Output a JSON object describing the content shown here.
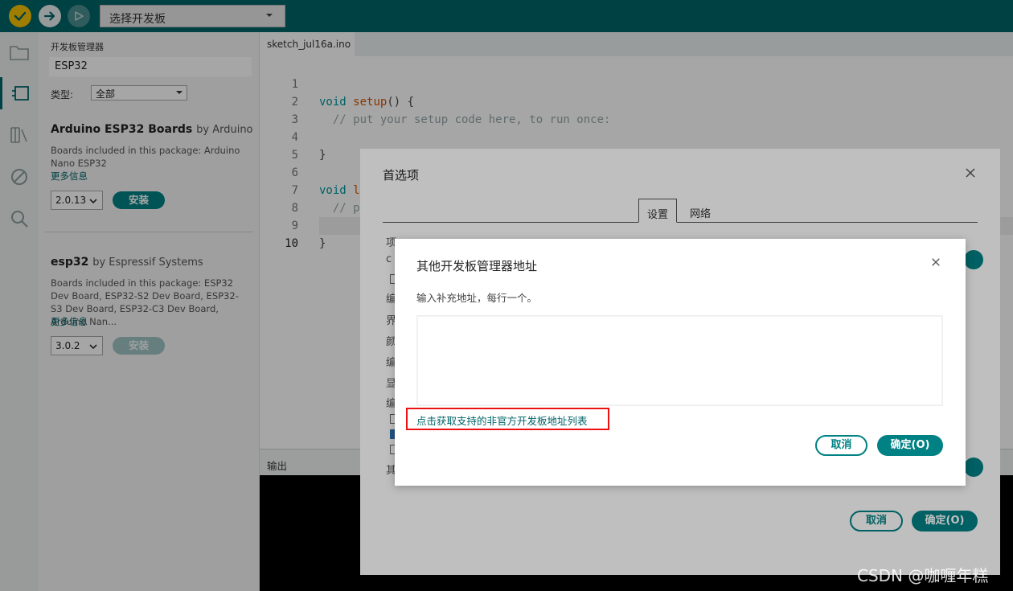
{
  "toolbar": {
    "verify_icon": "check-icon",
    "upload_icon": "arrow-right-icon",
    "debug_icon": "debug-icon",
    "board_select_value": "选择开发板"
  },
  "rail": {
    "items": [
      "folder-icon",
      "boards-manager-icon",
      "library-icon",
      "debug-stop-icon",
      "search-icon"
    ]
  },
  "boards_manager": {
    "title": "开发板管理器",
    "search_value": "ESP32",
    "type_label": "类型:",
    "type_value": "全部",
    "packages": [
      {
        "name": "Arduino ESP32 Boards",
        "by": "by Arduino",
        "description": "Boards included in this package: Arduino Nano ESP32",
        "more_info": "更多信息",
        "version": "2.0.13",
        "install_label": "安装"
      },
      {
        "name": "esp32",
        "by": "by Espressif Systems",
        "description": "Boards included in this package: ESP32 Dev Board, ESP32-S2 Dev Board, ESP32-S3 Dev Board, ESP32-C3 Dev Board, Arduino Nan...",
        "more_info": "更多信息",
        "version": "3.0.2",
        "install_label": "安装"
      }
    ]
  },
  "editor": {
    "tab_name": "sketch_jul16a.ino",
    "line_numbers": [
      "1",
      "2",
      "3",
      "4",
      "5",
      "6",
      "7",
      "8",
      "9",
      "10"
    ],
    "line1_kw": "void",
    "line1_fn": "setup",
    "line1_rest": "() {",
    "line2_comment": "  // put your setup code here, to run once:",
    "line4": "}",
    "line6_kw": "void",
    "line6_fn": "l",
    "line7_comment": "  // p",
    "line9": "}"
  },
  "output": {
    "tab_label": "输出"
  },
  "preferences_dialog": {
    "title": "首选项",
    "tab_settings": "设置",
    "tab_network": "网络",
    "peek_labels": [
      "项",
      "c",
      "编",
      "界",
      "颜",
      "编",
      "显",
      "编",
      "其"
    ],
    "cancel_label": "取消",
    "ok_label": "确定(O)"
  },
  "urls_dialog": {
    "title": "其他开发板管理器地址",
    "subtitle": "输入补充地址，每行一个。",
    "textarea_value": "",
    "link_label": "点击获取支持的非官方开发板地址列表",
    "cancel_label": "取消",
    "ok_label": "确定(O)"
  },
  "colors": {
    "toolbar": "#006468",
    "accent": "#008184",
    "verify": "#f5c000",
    "highlight_box": "#ee1111"
  },
  "watermark": "CSDN @咖喱年糕"
}
